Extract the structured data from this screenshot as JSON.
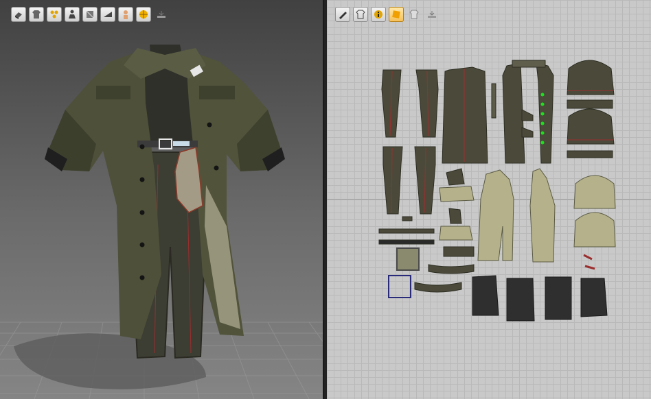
{
  "left_toolbar": {
    "buttons": [
      {
        "icon": "avatar-display-icon"
      },
      {
        "icon": "garment-shaded-icon"
      },
      {
        "icon": "particle-points-icon"
      },
      {
        "icon": "avatar-pose-icon"
      },
      {
        "icon": "texture-view-icon"
      },
      {
        "icon": "thickness-render-icon"
      },
      {
        "icon": "avatar-skin-icon"
      },
      {
        "icon": "environment-globe-icon"
      },
      {
        "icon": "ruler-measure-icon"
      }
    ]
  },
  "right_toolbar": {
    "buttons": [
      {
        "icon": "pen-visibility-icon"
      },
      {
        "icon": "garment-outline-icon"
      },
      {
        "icon": "info-icon"
      },
      {
        "icon": "fabric-texture-icon",
        "active": true
      },
      {
        "icon": "pattern-lock-icon"
      },
      {
        "icon": "ruler-measure-icon"
      }
    ]
  },
  "colors": {
    "viewport_top": "#414141",
    "viewport_bottom": "#858585",
    "pattern_window": "#c9c9c9",
    "fabric_dark_olive": "#4b4a3a",
    "fabric_light_khaki": "#b5b28b",
    "fabric_black": "#2f2f2f",
    "seam_red": "#9b2e2e",
    "pin_green": "#1ee01e"
  }
}
